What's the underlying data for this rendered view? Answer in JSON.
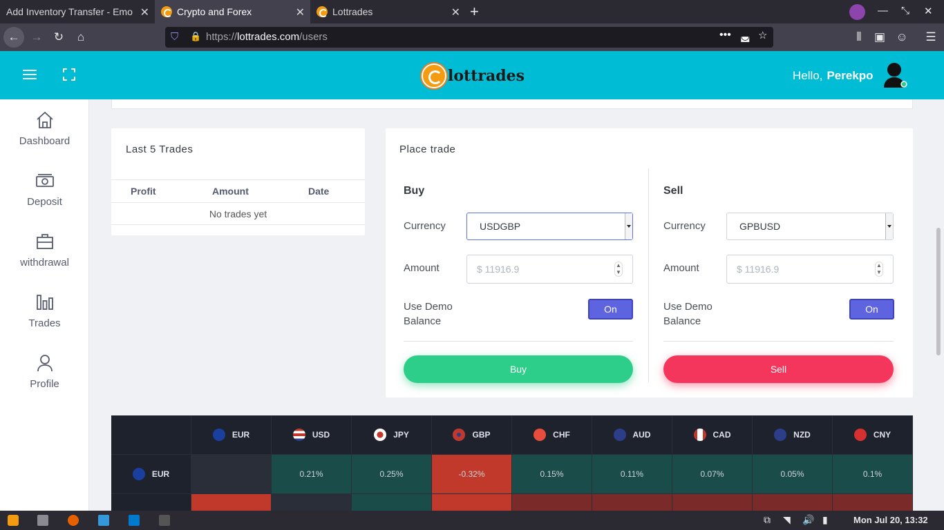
{
  "browser": {
    "tabs": [
      {
        "title": "Add Inventory Transfer - Emo"
      },
      {
        "title": "Crypto and Forex"
      },
      {
        "title": "Lottrades"
      }
    ],
    "url_prefix": "https://",
    "url_domain": "lottrades.com",
    "url_path": "/users"
  },
  "header": {
    "logo_text": "lottrades",
    "greeting": "Hello,",
    "username": "Perekpo"
  },
  "sidebar": {
    "items": [
      {
        "label": "Dashboard",
        "icon": "home-icon"
      },
      {
        "label": "Deposit",
        "icon": "money-icon"
      },
      {
        "label": "withdrawal",
        "icon": "briefcase-icon"
      },
      {
        "label": "Trades",
        "icon": "bar-chart-icon"
      },
      {
        "label": "Profile",
        "icon": "user-icon"
      }
    ]
  },
  "last_trades": {
    "title": "Last 5 Trades",
    "columns": [
      "Profit",
      "Amount",
      "Date"
    ],
    "empty_text": "No trades yet"
  },
  "place_trade": {
    "title": "Place trade",
    "buy": {
      "heading": "Buy",
      "currency_label": "Currency",
      "currency_value": "USDGBP",
      "amount_label": "Amount",
      "amount_placeholder": "$ 11916.9",
      "demo_label_1": "Use Demo",
      "demo_label_2": "Balance",
      "toggle_label": "On",
      "button_label": "Buy"
    },
    "sell": {
      "heading": "Sell",
      "currency_label": "Currency",
      "currency_value": "GPBUSD",
      "amount_label": "Amount",
      "amount_placeholder": "$ 11916.9",
      "demo_label_1": "Use Demo",
      "demo_label_2": "Balance",
      "toggle_label": "On",
      "button_label": "Sell"
    }
  },
  "forex_heatmap": {
    "columns": [
      "EUR",
      "USD",
      "JPY",
      "GBP",
      "CHF",
      "AUD",
      "CAD",
      "NZD",
      "CNY"
    ],
    "rows": [
      {
        "label": "EUR",
        "values": [
          "",
          "0.21%",
          "0.25%",
          "-0.32%",
          "0.15%",
          "0.11%",
          "0.07%",
          "0.05%",
          "0.1%"
        ]
      }
    ],
    "colors": {
      "positive": "#1a4d4a",
      "negative": "#c0392b",
      "neutral": "#2a2e39"
    }
  },
  "taskbar": {
    "clock": "Mon Jul 20, 13:32"
  },
  "colors": {
    "header": "#00bcd4",
    "buy": "#2dce89",
    "sell": "#f5365c",
    "toggle": "#5e63e0"
  }
}
